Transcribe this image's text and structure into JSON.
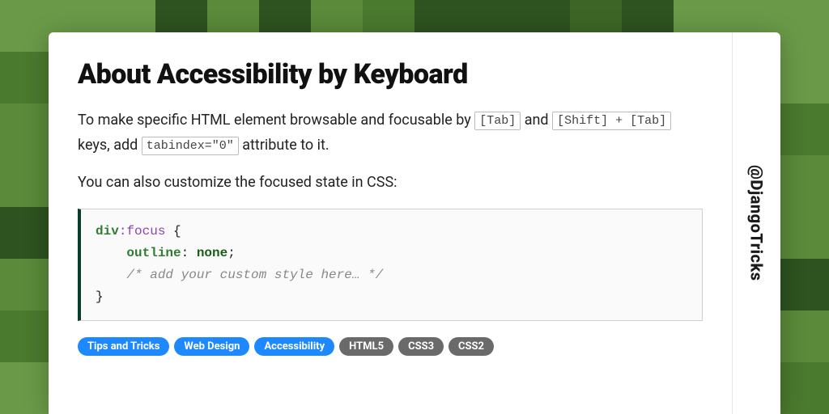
{
  "title": "About Accessibility by Keyboard",
  "handle": "@DjangoTricks",
  "para1": {
    "pre": "To make specific HTML element browsable and focusable by ",
    "kbd1": "[Tab]",
    "mid1": " and ",
    "kbd2": "[Shift] + [Tab]",
    "mid2": " keys, add ",
    "kbd3": "tabindex=\"0\"",
    "post": " attribute to it."
  },
  "para2": "You can also customize the focused state in CSS:",
  "code": {
    "sel": "div",
    "pseudo": ":focus",
    "open": " {",
    "indent": "    ",
    "prop": "outline",
    "colon": ": ",
    "val": "none",
    "semi": ";",
    "comment": "/* add your custom style here… */",
    "close": "}"
  },
  "tags": [
    {
      "label": "Tips and Tricks",
      "style": "blue"
    },
    {
      "label": "Web Design",
      "style": "blue"
    },
    {
      "label": "Accessibility",
      "style": "blue"
    },
    {
      "label": "HTML5",
      "style": "gray"
    },
    {
      "label": "CSS3",
      "style": "gray"
    },
    {
      "label": "CSS2",
      "style": "gray"
    }
  ]
}
